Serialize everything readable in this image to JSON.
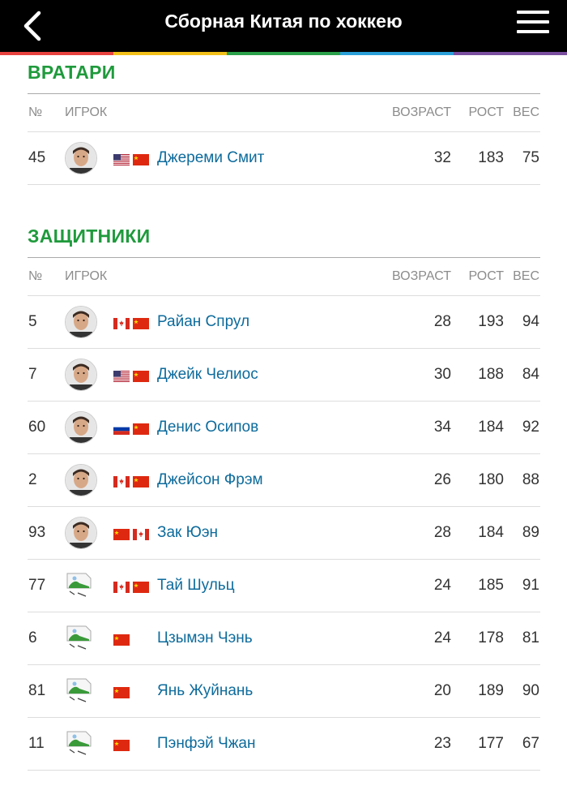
{
  "header": {
    "title": "Сборная Китая по хоккею"
  },
  "stripe_colors": [
    "#e8423f",
    "#f3c019",
    "#2aa14a",
    "#2a9fd8",
    "#7b4ea0"
  ],
  "columns": {
    "num": "№",
    "player": "ИГРОК",
    "age": "ВОЗРАСТ",
    "height": "РОСТ",
    "weight": "ВЕС"
  },
  "goalies": {
    "title": "ВРАТАРИ",
    "players": [
      {
        "num": "45",
        "name": "Джереми Смит",
        "age": "32",
        "height": "183",
        "weight": "75",
        "flags": [
          "us",
          "cn"
        ],
        "photo": "face"
      }
    ]
  },
  "defenders": {
    "title": "ЗАЩИТНИКИ",
    "players": [
      {
        "num": "5",
        "name": "Райан Спрул",
        "age": "28",
        "height": "193",
        "weight": "94",
        "flags": [
          "ca",
          "cn"
        ],
        "photo": "face"
      },
      {
        "num": "7",
        "name": "Джейк Челиос",
        "age": "30",
        "height": "188",
        "weight": "84",
        "flags": [
          "us",
          "cn"
        ],
        "photo": "face"
      },
      {
        "num": "60",
        "name": "Денис Осипов",
        "age": "34",
        "height": "184",
        "weight": "92",
        "flags": [
          "ru",
          "cn"
        ],
        "photo": "face"
      },
      {
        "num": "2",
        "name": "Джейсон Фрэм",
        "age": "26",
        "height": "180",
        "weight": "88",
        "flags": [
          "ca",
          "cn"
        ],
        "photo": "face"
      },
      {
        "num": "93",
        "name": "Зак Юэн",
        "age": "28",
        "height": "184",
        "weight": "89",
        "flags": [
          "cn",
          "ca"
        ],
        "photo": "face"
      },
      {
        "num": "77",
        "name": "Тай Шульц",
        "age": "24",
        "height": "185",
        "weight": "91",
        "flags": [
          "ca",
          "cn"
        ],
        "photo": "broken"
      },
      {
        "num": "6",
        "name": "Цзымэн Чэнь",
        "age": "24",
        "height": "178",
        "weight": "81",
        "flags": [
          "cn"
        ],
        "photo": "broken"
      },
      {
        "num": "81",
        "name": "Янь Жуйнань",
        "age": "20",
        "height": "189",
        "weight": "90",
        "flags": [
          "cn"
        ],
        "photo": "broken"
      },
      {
        "num": "11",
        "name": "Пэнфэй Чжан",
        "age": "23",
        "height": "177",
        "weight": "67",
        "flags": [
          "cn"
        ],
        "photo": "broken"
      }
    ]
  }
}
